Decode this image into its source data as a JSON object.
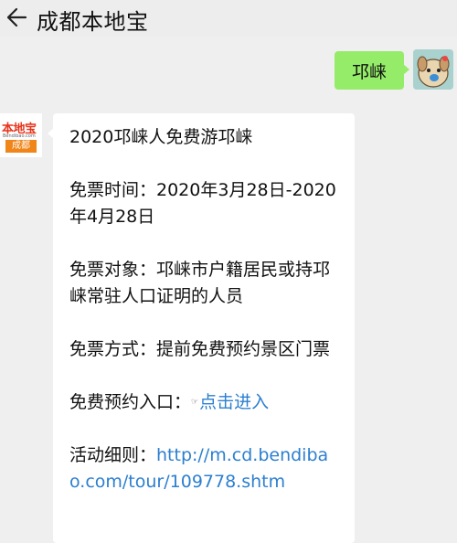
{
  "header": {
    "title": "成都本地宝",
    "back_icon": "back-arrow-icon"
  },
  "messages": {
    "user": {
      "text": "邛崃",
      "bubble_color": "#95ec69"
    },
    "bot": {
      "avatar": {
        "logo_text": "本地宝",
        "logo_url": "Bendibao.com",
        "logo_city": "成都"
      },
      "title": "2020邛崃人免费游邛崃",
      "time_text": "免票时间：2020年3月28日-2020年4月28日",
      "target_text": "免票对象：邛崃市户籍居民或持邛崃常驻人口证明的人员",
      "method_text": "免票方式：提前免费预约景区门票",
      "booking_label": "免费预约入口：",
      "booking_icon": "link-icon",
      "booking_link": "点击进入",
      "detail_label": "活动细则：",
      "detail_link": "http://m.cd.bendibao.com/tour/109778.shtm"
    }
  },
  "colors": {
    "link": "#2c7fcf",
    "background": "#efefef"
  }
}
